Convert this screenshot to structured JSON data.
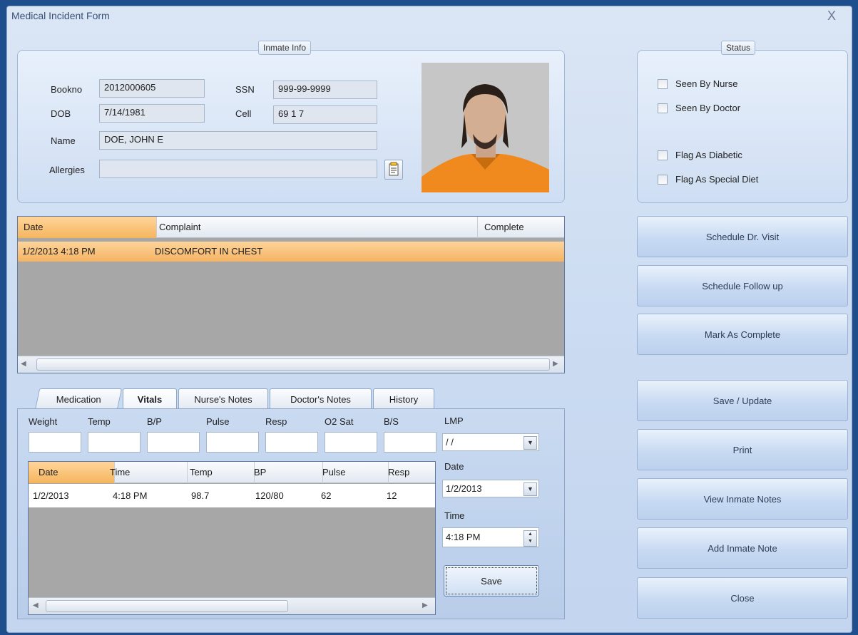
{
  "window": {
    "title": "Medical Incident Form",
    "close_glyph": "X"
  },
  "inmate_info": {
    "legend": "Inmate Info",
    "bookno_label": "Bookno",
    "bookno": "2012000605",
    "ssn_label": "SSN",
    "ssn": "999-99-9999",
    "dob_label": "DOB",
    "dob": "7/14/1981",
    "cell_label": "Cell",
    "cell": "69  1 7",
    "name_label": "Name",
    "name": "DOE, JOHN E",
    "allergies_label": "Allergies",
    "allergies": ""
  },
  "status": {
    "legend": "Status",
    "seen_by_nurse": "Seen By Nurse",
    "seen_by_doctor": "Seen By Doctor",
    "flag_diabetic": "Flag As Diabetic",
    "flag_special_diet": "Flag As Special Diet"
  },
  "incidents": {
    "headers": [
      "Date",
      "Complaint",
      "Complete"
    ],
    "rows": [
      {
        "date": "1/2/2013 4:18 PM",
        "complaint": "DISCOMFORT IN CHEST",
        "complete": ""
      }
    ]
  },
  "tabs": [
    "Medication",
    "Vitals",
    "Nurse's Notes",
    "Doctor's Notes",
    "History"
  ],
  "vitals": {
    "labels": [
      "Weight",
      "Temp",
      "B/P",
      "Pulse",
      "Resp",
      "O2 Sat",
      "B/S"
    ],
    "lmp_label": "LMP",
    "lmp": " /  /",
    "date_label": "Date",
    "date": "1/2/2013",
    "time_label": "Time",
    "time": "4:18  PM",
    "save": "Save",
    "grid_headers": [
      "Date",
      "Time",
      "Temp",
      "BP",
      "Pulse",
      "Resp"
    ],
    "grid_rows": [
      {
        "date": "1/2/2013",
        "time": "4:18 PM",
        "temp": "98.7",
        "bp": "120/80",
        "pulse": "62",
        "resp": "12"
      }
    ]
  },
  "actions": {
    "schedule_dr_visit": "Schedule Dr. Visit",
    "schedule_follow_up": "Schedule Follow up",
    "mark_complete": "Mark As Complete",
    "save_update": "Save / Update",
    "print": "Print",
    "view_notes": "View Inmate Notes",
    "add_note": "Add Inmate Note",
    "close": "Close"
  },
  "icons": {
    "allergies_button": "notepad-icon",
    "scroll_left": "arrow-left-icon",
    "scroll_right": "arrow-right-icon"
  },
  "colors": {
    "selected_row": "#f6b363",
    "window_bg": "#c9daf1",
    "desktop_bg": "#1f4e8c"
  }
}
